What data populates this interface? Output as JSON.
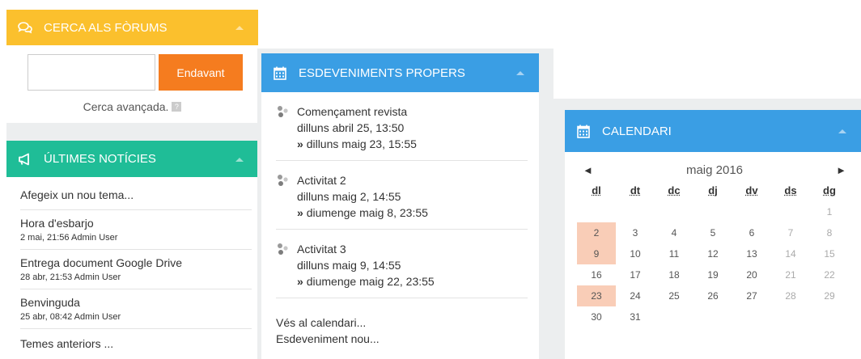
{
  "search": {
    "title": "CERCA ALS FÒRUMS",
    "button_label": "Endavant",
    "input_value": "",
    "advanced_label": "Cerca avançada."
  },
  "news": {
    "title": "ÚLTIMES NOTÍCIES",
    "add_topic": "Afegeix un nou tema...",
    "items": [
      {
        "title": "Hora d'esbarjo",
        "meta": "2 mai, 21:56  Admin User"
      },
      {
        "title": "Entrega document Google Drive",
        "meta": "28 abr, 21:53  Admin User"
      },
      {
        "title": "Benvinguda",
        "meta": "25 abr, 08:42  Admin User"
      }
    ],
    "older_topics": "Temes anteriors ..."
  },
  "events": {
    "title": "ESDEVENIMENTS PROPERS",
    "items": [
      {
        "name": "Començament revista",
        "start": "dilluns abril 25, 13:50",
        "end": "dilluns maig 23, 15:55"
      },
      {
        "name": "Activitat 2",
        "start": "dilluns maig 2, 14:55",
        "end": "diumenge maig 8, 23:55"
      },
      {
        "name": "Activitat 3",
        "start": "dilluns maig 9, 14:55",
        "end": "diumenge maig 22, 23:55"
      }
    ],
    "goto_calendar": "Vés al calendari...",
    "new_event": "Esdeveniment nou...",
    "end_marker": "»"
  },
  "calendar": {
    "title": "CALENDARI",
    "month": "maig 2016",
    "prev": "◄",
    "next": "►",
    "weekdays": [
      "dl",
      "dt",
      "dc",
      "dj",
      "dv",
      "ds",
      "dg"
    ],
    "weeks": [
      [
        "",
        "",
        "",
        "",
        "",
        "",
        "1"
      ],
      [
        "2",
        "3",
        "4",
        "5",
        "6",
        "7",
        "8"
      ],
      [
        "9",
        "10",
        "11",
        "12",
        "13",
        "14",
        "15"
      ],
      [
        "16",
        "17",
        "18",
        "19",
        "20",
        "21",
        "22"
      ],
      [
        "23",
        "24",
        "25",
        "26",
        "27",
        "28",
        "29"
      ],
      [
        "30",
        "31",
        "",
        "",
        "",
        "",
        ""
      ]
    ],
    "event_days": [
      "2",
      "9",
      "23"
    ]
  },
  "colors": {
    "search_header": "#fbc02d",
    "news_header": "#1fbd97",
    "blue_header": "#3a9ee4",
    "button": "#f57c1f",
    "event_day": "#f9cdb7"
  }
}
